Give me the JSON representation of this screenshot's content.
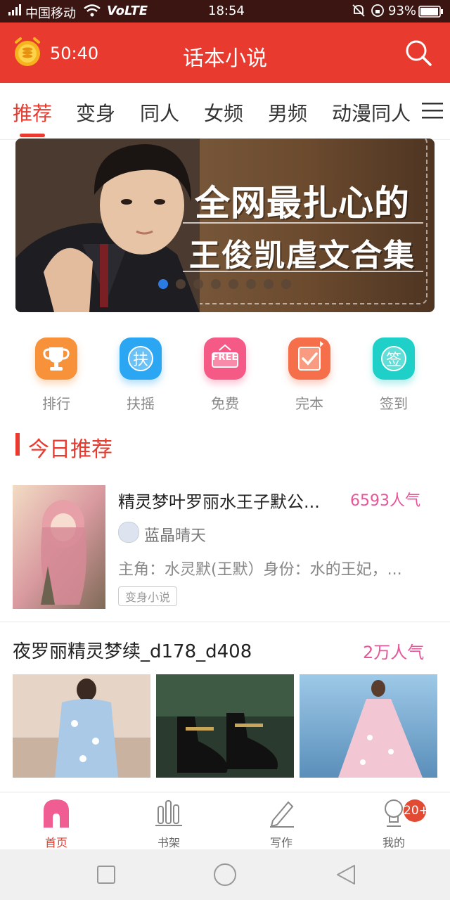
{
  "status_bar": {
    "carrier": "中国移动",
    "network": "VoLTE",
    "time": "18:54",
    "battery": "93%"
  },
  "header": {
    "timer": "50:40",
    "title": "话本小说"
  },
  "tabs": [
    {
      "label": "推荐",
      "active": true
    },
    {
      "label": "变身"
    },
    {
      "label": "同人"
    },
    {
      "label": "女频"
    },
    {
      "label": "男频"
    },
    {
      "label": "动漫同人"
    }
  ],
  "banner": {
    "line1": "全网最扎心的",
    "line2": "王俊凯虐文合集",
    "active_slide": 1,
    "slide_count": 8
  },
  "quick_actions": [
    {
      "label": "排行",
      "glyph": "",
      "color": "#f7913a",
      "icon": "trophy-icon"
    },
    {
      "label": "扶摇",
      "glyph": "扶",
      "color": "#2aa6f2",
      "icon": "fuyao-icon"
    },
    {
      "label": "免费",
      "glyph": "FREE",
      "color": "#f55a86",
      "icon": "free-icon"
    },
    {
      "label": "完本",
      "glyph": "",
      "color": "#f5704a",
      "icon": "check-icon"
    },
    {
      "label": "签到",
      "glyph": "签",
      "color": "#1fd0c8",
      "icon": "sign-icon"
    }
  ],
  "section": {
    "title": "今日推荐"
  },
  "featured_book": {
    "title": "精灵梦叶罗丽水王子默公...",
    "popularity": "6593人气",
    "author": "蓝晶晴天",
    "description": "主角：水灵默(王默）身份：水的王妃，...",
    "tag": "变身小说"
  },
  "second_book": {
    "title": "夜罗丽精灵梦续_d178_d408",
    "popularity": "2万人气"
  },
  "bottom_nav": [
    {
      "label": "首页",
      "active": true,
      "icon": "home-icon"
    },
    {
      "label": "书架",
      "icon": "bookshelf-icon"
    },
    {
      "label": "写作",
      "icon": "pencil-icon"
    },
    {
      "label": "我的",
      "icon": "profile-icon"
    }
  ],
  "notification_badge": "20+",
  "colors": {
    "accent": "#e83a2e",
    "popularity": "#e8569a"
  }
}
